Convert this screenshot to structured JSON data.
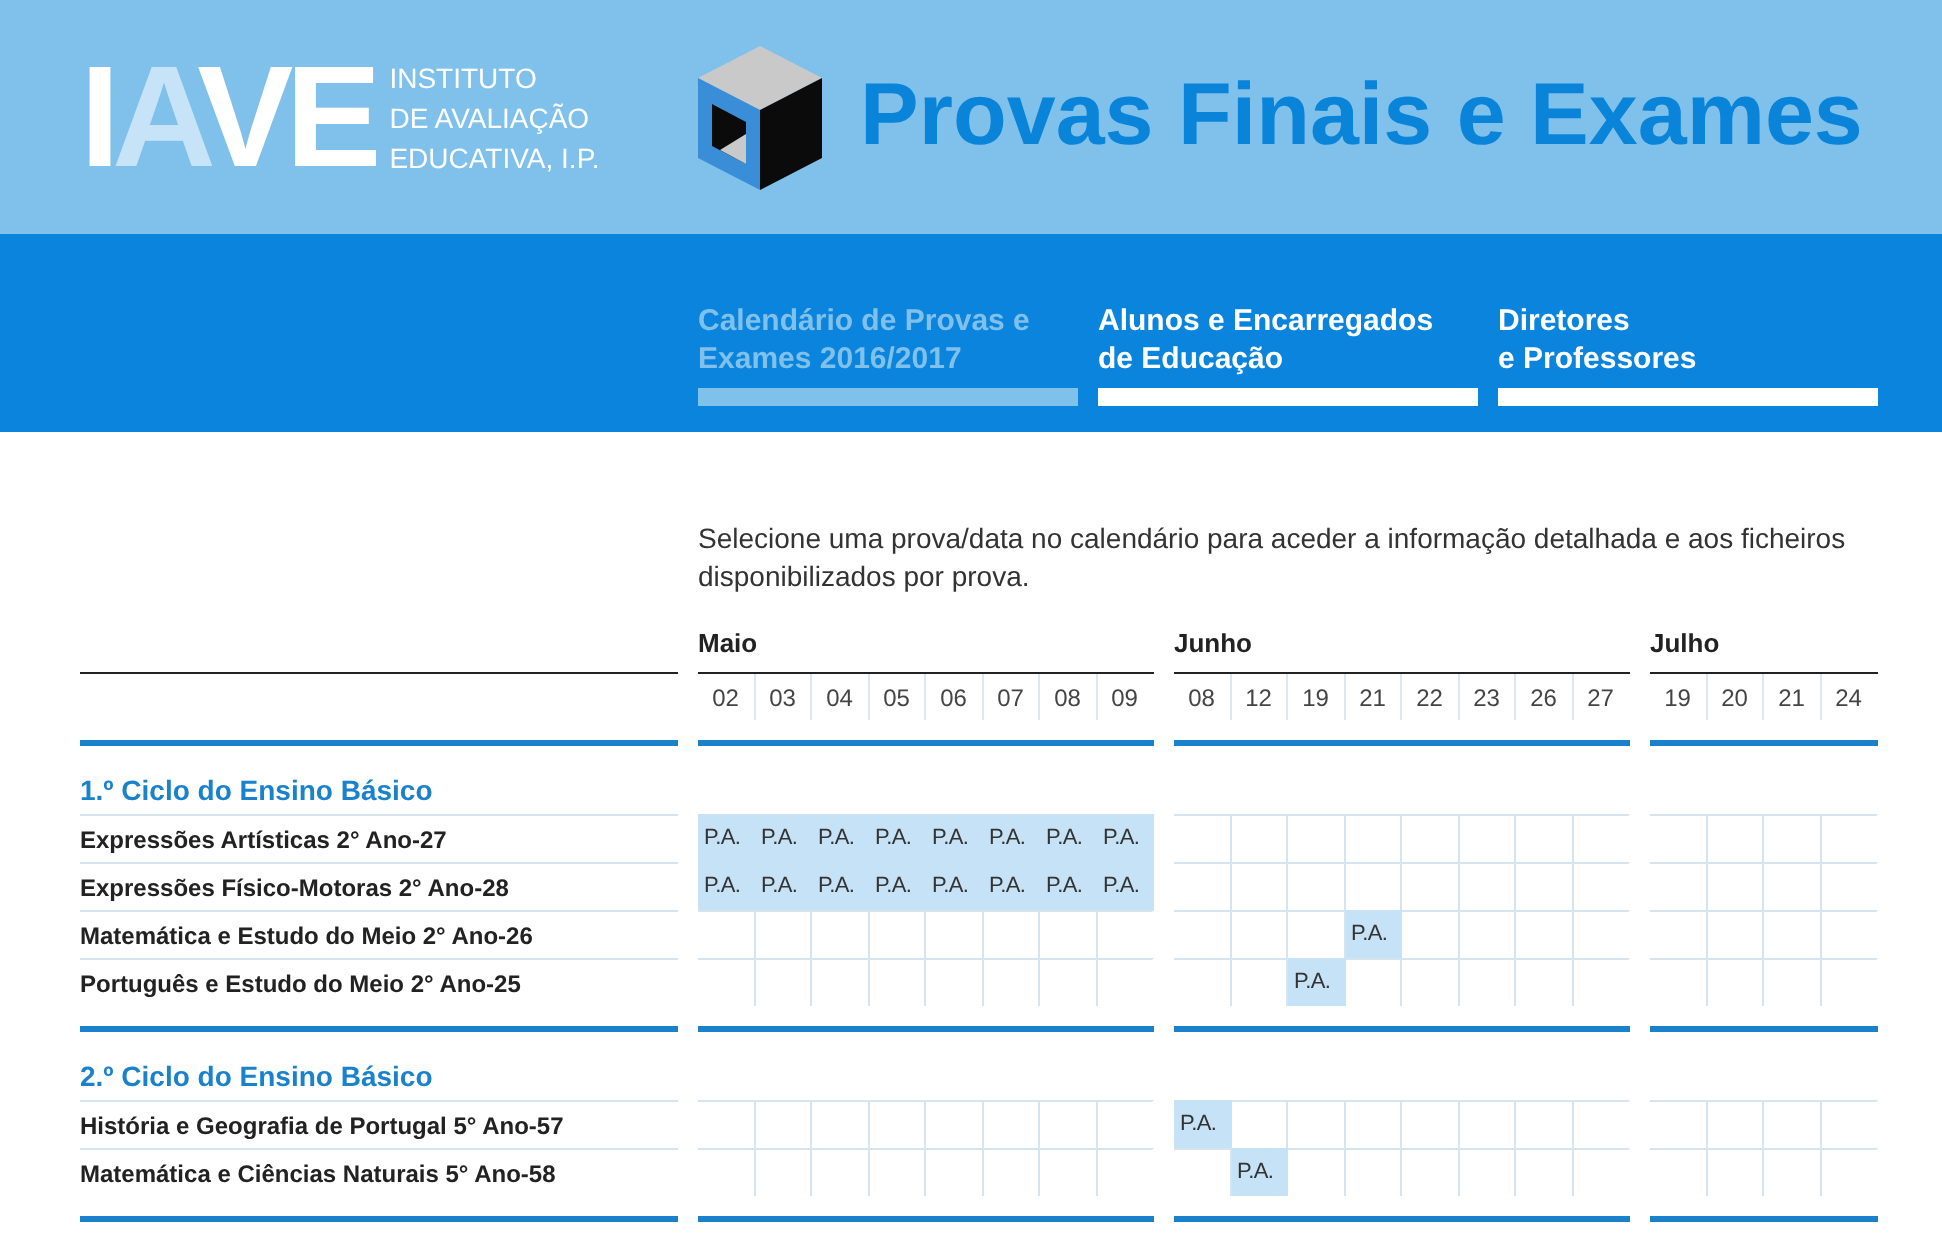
{
  "header": {
    "logo": [
      {
        "text": "I",
        "tint": false
      },
      {
        "text": "A",
        "tint": true
      },
      {
        "text": "VE",
        "tint": false
      }
    ],
    "institute": [
      "INSTITUTO",
      "DE AVALIAÇÃO",
      "EDUCATIVA, I.P."
    ],
    "title": "Provas Finais e Exames"
  },
  "nav": [
    {
      "lines": [
        "Calendário de Provas e",
        "Exames 2016/2017"
      ],
      "selected": true
    },
    {
      "lines": [
        "Alunos e Encarregados",
        "de Educação"
      ],
      "selected": false
    },
    {
      "lines": [
        "Diretores",
        "e Professores"
      ],
      "selected": false
    }
  ],
  "intro": "Selecione uma prova/data no calendário para aceder a informação detalhada e aos ficheiros disponibilizados por prova.",
  "calendar": {
    "months": [
      {
        "name": "Maio",
        "days": [
          "02",
          "03",
          "04",
          "05",
          "06",
          "07",
          "08",
          "09"
        ]
      },
      {
        "name": "Junho",
        "days": [
          "08",
          "12",
          "19",
          "21",
          "22",
          "23",
          "26",
          "27"
        ]
      },
      {
        "name": "Julho",
        "days": [
          "19",
          "20",
          "21",
          "24"
        ]
      }
    ],
    "sections": [
      {
        "title": "1.º Ciclo do Ensino Básico",
        "rows": [
          {
            "label": "Expressões Artísticas 2° Ano-27",
            "months": [
              {
                "cells": [
                  {
                    "marked": true,
                    "text": "P.A."
                  },
                  {
                    "marked": true,
                    "text": "P.A."
                  },
                  {
                    "marked": true,
                    "text": "P.A."
                  },
                  {
                    "marked": true,
                    "text": "P.A."
                  },
                  {
                    "marked": true,
                    "text": "P.A."
                  },
                  {
                    "marked": true,
                    "text": "P.A."
                  },
                  {
                    "marked": true,
                    "text": "P.A."
                  },
                  {
                    "marked": true,
                    "text": "P.A."
                  }
                ]
              },
              {
                "cells": [
                  {
                    "marked": false
                  },
                  {
                    "marked": false
                  },
                  {
                    "marked": false
                  },
                  {
                    "marked": false
                  },
                  {
                    "marked": false
                  },
                  {
                    "marked": false
                  },
                  {
                    "marked": false
                  },
                  {
                    "marked": false
                  }
                ]
              },
              {
                "cells": [
                  {
                    "marked": false
                  },
                  {
                    "marked": false
                  },
                  {
                    "marked": false
                  },
                  {
                    "marked": false
                  }
                ]
              }
            ]
          },
          {
            "label": "Expressões Físico-Motoras 2° Ano-28",
            "months": [
              {
                "cells": [
                  {
                    "marked": true,
                    "text": "P.A."
                  },
                  {
                    "marked": true,
                    "text": "P.A."
                  },
                  {
                    "marked": true,
                    "text": "P.A."
                  },
                  {
                    "marked": true,
                    "text": "P.A."
                  },
                  {
                    "marked": true,
                    "text": "P.A."
                  },
                  {
                    "marked": true,
                    "text": "P.A."
                  },
                  {
                    "marked": true,
                    "text": "P.A."
                  },
                  {
                    "marked": true,
                    "text": "P.A."
                  }
                ]
              },
              {
                "cells": [
                  {
                    "marked": false
                  },
                  {
                    "marked": false
                  },
                  {
                    "marked": false
                  },
                  {
                    "marked": false
                  },
                  {
                    "marked": false
                  },
                  {
                    "marked": false
                  },
                  {
                    "marked": false
                  },
                  {
                    "marked": false
                  }
                ]
              },
              {
                "cells": [
                  {
                    "marked": false
                  },
                  {
                    "marked": false
                  },
                  {
                    "marked": false
                  },
                  {
                    "marked": false
                  }
                ]
              }
            ]
          },
          {
            "label": "Matemática e Estudo do Meio 2° Ano-26",
            "months": [
              {
                "cells": [
                  {
                    "marked": false
                  },
                  {
                    "marked": false
                  },
                  {
                    "marked": false
                  },
                  {
                    "marked": false
                  },
                  {
                    "marked": false
                  },
                  {
                    "marked": false
                  },
                  {
                    "marked": false
                  },
                  {
                    "marked": false
                  }
                ]
              },
              {
                "cells": [
                  {
                    "marked": false
                  },
                  {
                    "marked": false
                  },
                  {
                    "marked": false
                  },
                  {
                    "marked": true,
                    "text": "P.A."
                  },
                  {
                    "marked": false
                  },
                  {
                    "marked": false
                  },
                  {
                    "marked": false
                  },
                  {
                    "marked": false
                  }
                ]
              },
              {
                "cells": [
                  {
                    "marked": false
                  },
                  {
                    "marked": false
                  },
                  {
                    "marked": false
                  },
                  {
                    "marked": false
                  }
                ]
              }
            ]
          },
          {
            "label": "Português e Estudo do Meio 2° Ano-25",
            "months": [
              {
                "cells": [
                  {
                    "marked": false
                  },
                  {
                    "marked": false
                  },
                  {
                    "marked": false
                  },
                  {
                    "marked": false
                  },
                  {
                    "marked": false
                  },
                  {
                    "marked": false
                  },
                  {
                    "marked": false
                  },
                  {
                    "marked": false
                  }
                ]
              },
              {
                "cells": [
                  {
                    "marked": false
                  },
                  {
                    "marked": false
                  },
                  {
                    "marked": true,
                    "text": "P.A."
                  },
                  {
                    "marked": false
                  },
                  {
                    "marked": false
                  },
                  {
                    "marked": false
                  },
                  {
                    "marked": false
                  },
                  {
                    "marked": false
                  }
                ]
              },
              {
                "cells": [
                  {
                    "marked": false
                  },
                  {
                    "marked": false
                  },
                  {
                    "marked": false
                  },
                  {
                    "marked": false
                  }
                ]
              }
            ]
          }
        ]
      },
      {
        "title": "2.º Ciclo do Ensino Básico",
        "rows": [
          {
            "label": "História e Geografia de Portugal 5° Ano-57",
            "months": [
              {
                "cells": [
                  {
                    "marked": false
                  },
                  {
                    "marked": false
                  },
                  {
                    "marked": false
                  },
                  {
                    "marked": false
                  },
                  {
                    "marked": false
                  },
                  {
                    "marked": false
                  },
                  {
                    "marked": false
                  },
                  {
                    "marked": false
                  }
                ]
              },
              {
                "cells": [
                  {
                    "marked": true,
                    "text": "P.A."
                  },
                  {
                    "marked": false
                  },
                  {
                    "marked": false
                  },
                  {
                    "marked": false
                  },
                  {
                    "marked": false
                  },
                  {
                    "marked": false
                  },
                  {
                    "marked": false
                  },
                  {
                    "marked": false
                  }
                ]
              },
              {
                "cells": [
                  {
                    "marked": false
                  },
                  {
                    "marked": false
                  },
                  {
                    "marked": false
                  },
                  {
                    "marked": false
                  }
                ]
              }
            ]
          },
          {
            "label": "Matemática e Ciências Naturais 5° Ano-58",
            "months": [
              {
                "cells": [
                  {
                    "marked": false
                  },
                  {
                    "marked": false
                  },
                  {
                    "marked": false
                  },
                  {
                    "marked": false
                  },
                  {
                    "marked": false
                  },
                  {
                    "marked": false
                  },
                  {
                    "marked": false
                  },
                  {
                    "marked": false
                  }
                ]
              },
              {
                "cells": [
                  {
                    "marked": false
                  },
                  {
                    "marked": true,
                    "text": "P.A."
                  },
                  {
                    "marked": false
                  },
                  {
                    "marked": false
                  },
                  {
                    "marked": false
                  },
                  {
                    "marked": false
                  },
                  {
                    "marked": false
                  },
                  {
                    "marked": false
                  }
                ]
              },
              {
                "cells": [
                  {
                    "marked": false
                  },
                  {
                    "marked": false
                  },
                  {
                    "marked": false
                  },
                  {
                    "marked": false
                  }
                ]
              }
            ]
          }
        ]
      }
    ]
  }
}
